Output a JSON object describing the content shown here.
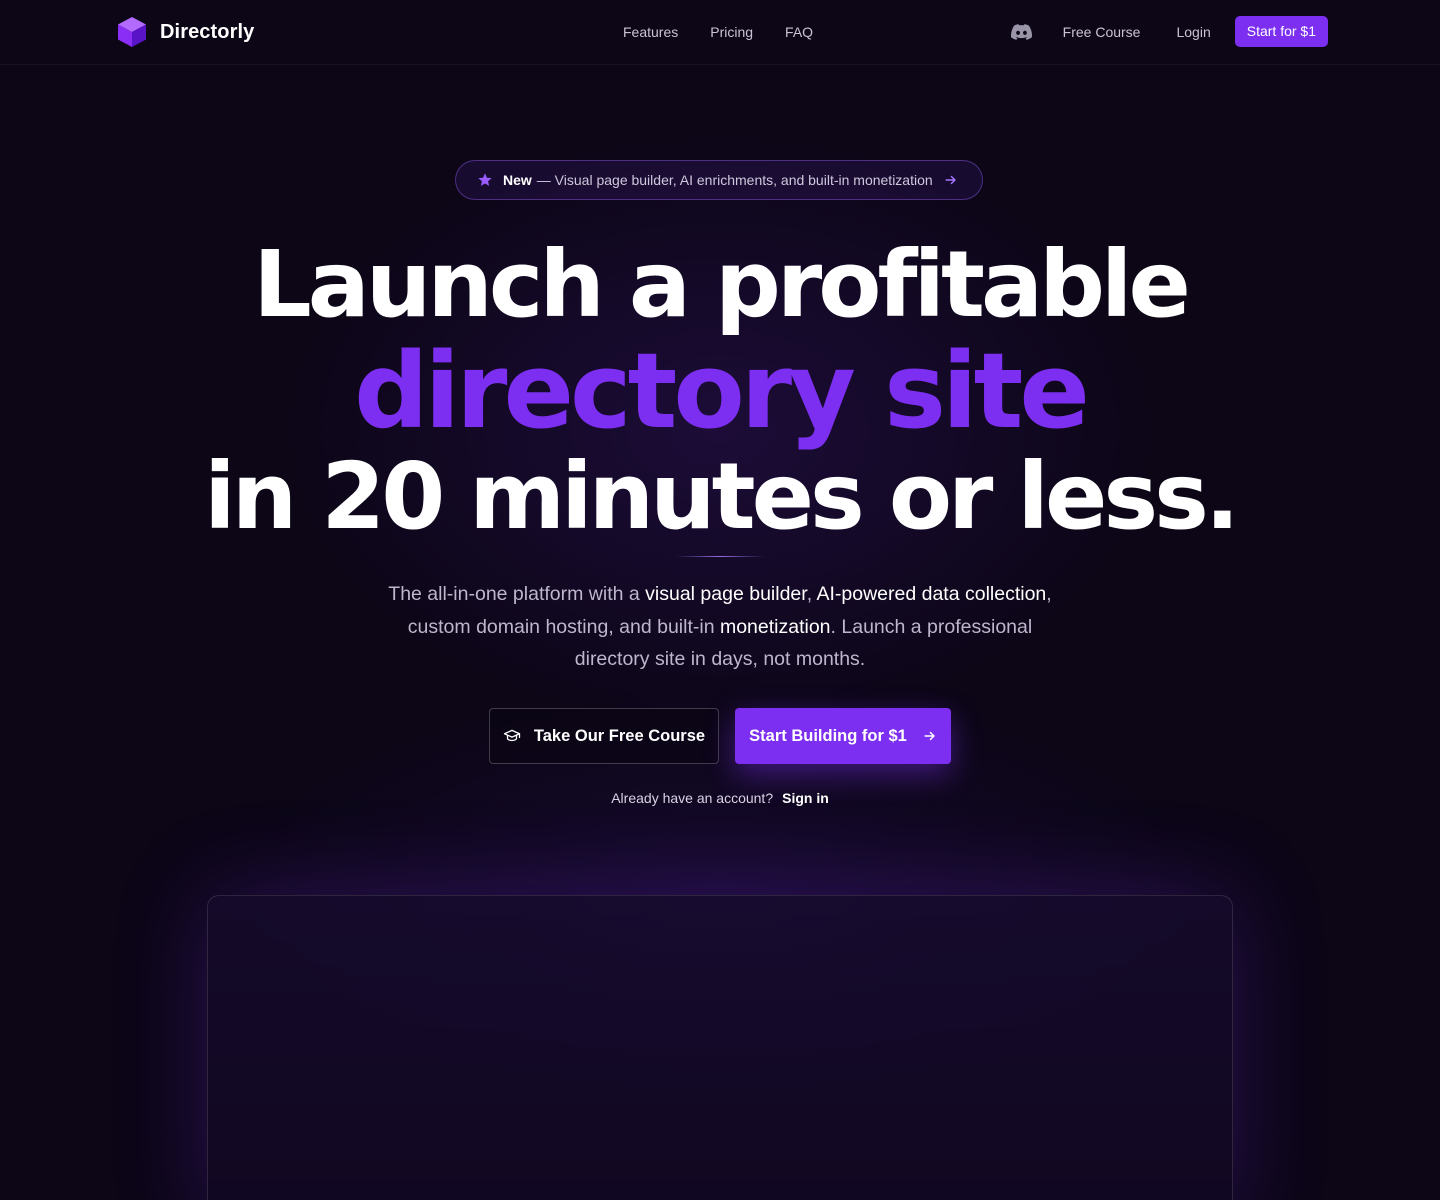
{
  "brand": {
    "name": "Directorly"
  },
  "nav": {
    "links": [
      "Features",
      "Pricing",
      "FAQ"
    ],
    "free_course": "Free Course",
    "login": "Login",
    "start": "Start for $1"
  },
  "announcement": {
    "badge": "New",
    "text": "— Visual page builder, AI enrichments, and built-in monetization"
  },
  "hero": {
    "line1": "Launch a profitable",
    "line2": "directory site",
    "line3": "in 20 minutes or less.",
    "sub": {
      "p1": "The all-in-one platform with a ",
      "b1": "visual page builder",
      "p2": ", ",
      "b2": "AI-powered data collection",
      "p3": ", custom domain hosting, and built-in ",
      "b3": "monetization",
      "p4": ". Launch a professional directory site in days, not months."
    }
  },
  "cta": {
    "course": "Take Our Free Course",
    "build": "Start Building for $1",
    "already": "Already have an account?",
    "signin": "Sign in"
  },
  "colors": {
    "accent": "#7c2ff0",
    "background": "#0c0617"
  },
  "icons": [
    "cube-logo-icon",
    "discord-icon",
    "star-icon",
    "arrow-right-icon",
    "graduation-cap-icon"
  ]
}
